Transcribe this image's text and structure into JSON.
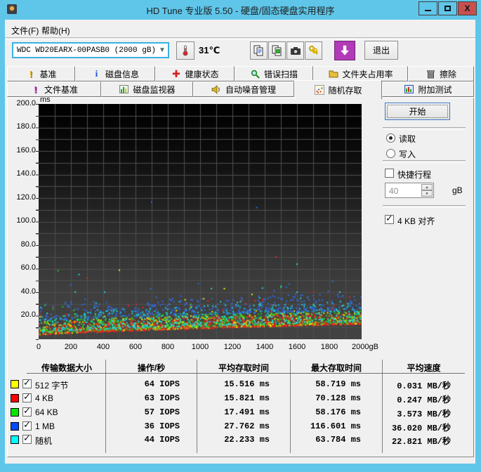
{
  "window": {
    "title": "HD Tune 专业版 5.50 - 硬盘/固态硬盘实用程序",
    "controls": {
      "close": "X"
    }
  },
  "menu": {
    "items": [
      {
        "label": "文件(F)"
      },
      {
        "label": "帮助(H)"
      }
    ]
  },
  "toolbar": {
    "drive_selected": "WDC WD20EARX-00PASB0  (2000 gB)",
    "temperature": "31℃",
    "exit_label": "退出"
  },
  "tabs": {
    "row1": [
      {
        "label": "基准"
      },
      {
        "label": "磁盘信息"
      },
      {
        "label": "健康状态"
      },
      {
        "label": "错误扫描"
      },
      {
        "label": "文件夹占用率"
      },
      {
        "label": "擦除"
      }
    ],
    "row2": [
      {
        "label": "文件基准"
      },
      {
        "label": "磁盘监视器"
      },
      {
        "label": "自动噪音管理"
      },
      {
        "label": "随机存取",
        "active": true
      },
      {
        "label": "附加测试"
      }
    ]
  },
  "panel": {
    "start_label": "开始",
    "read_label": "读取",
    "write_label": "写入",
    "read_selected": true,
    "write_selected": false,
    "shortstroke_label": "快捷行程",
    "shortstroke_checked": false,
    "shortstroke_value": "40",
    "shortstroke_unit": "gB",
    "align_label": "4 KB 对齐",
    "align_checked": true
  },
  "chart_data": {
    "type": "scatter",
    "y_unit": "ms",
    "x_unit": "gB",
    "xlim": [
      0,
      2000
    ],
    "ylim": [
      0,
      200
    ],
    "x_tick_labels": [
      "0",
      "200",
      "400",
      "600",
      "800",
      "1000",
      "1200",
      "1400",
      "1600",
      "1800",
      "2000gB"
    ],
    "y_tick_labels": [
      "200.0",
      "180.0",
      "160.0",
      "140.0",
      "120.0",
      "100.0",
      "80.0",
      "60.0",
      "40.0",
      "20.0"
    ],
    "grid": {
      "x_step": 100,
      "y_step": 10
    },
    "grid_color": "#4f4f4f",
    "bg_gradient": [
      "#000000",
      "#0c0c0c",
      "#1f1f1f",
      "#333333",
      "#3f3f3f",
      "#434343"
    ],
    "seed": 1337,
    "baseline": {
      "b0": 3.2,
      "rise": 9.5,
      "pow": 0.75
    },
    "draw_order": [
      0,
      2,
      1,
      4,
      3
    ],
    "series": [
      {
        "name": "512 字节",
        "dot_color": "#eded00",
        "count": 650,
        "offset": 0.4,
        "spread": 11,
        "tail": 18,
        "tail_p": 0.05,
        "outliers": [
          [
            500,
            58.7
          ],
          [
            1150,
            43
          ]
        ],
        "stats": {
          "iops": "64 IOPS",
          "avg_access": "15.516 ms",
          "max_access": "58.719 ms",
          "avg_speed": "0.031 MB/秒"
        }
      },
      {
        "name": "4 KB",
        "dot_color": "#ee2222",
        "count": 650,
        "offset": 0.0,
        "spread": 10,
        "tail": 22,
        "tail_p": 0.05,
        "outliers": [
          [
            1470,
            70.1
          ],
          [
            300,
            52
          ]
        ],
        "stats": {
          "iops": "63 IOPS",
          "avg_access": "15.821 ms",
          "max_access": "70.128 ms",
          "avg_speed": "0.247 MB/秒"
        }
      },
      {
        "name": "64 KB",
        "dot_color": "#22cc22",
        "count": 620,
        "offset": 1.2,
        "spread": 12,
        "tail": 16,
        "tail_p": 0.06,
        "outliers": [
          [
            120,
            58.2
          ],
          [
            1500,
            44
          ]
        ],
        "stats": {
          "iops": "57 IOPS",
          "avg_access": "17.491 ms",
          "max_access": "58.176 ms",
          "avg_speed": "3.573 MB/秒"
        }
      },
      {
        "name": "1 MB",
        "dot_color": "#2e6be8",
        "count": 430,
        "offset": 12,
        "spread": 15,
        "tail": 18,
        "tail_p": 0.05,
        "outliers": [
          [
            700,
            116.6
          ],
          [
            1350,
            112
          ]
        ],
        "stats": {
          "iops": "36 IOPS",
          "avg_access": "27.762 ms",
          "max_access": "116.601 ms",
          "avg_speed": "36.020 MB/秒"
        }
      },
      {
        "name": "随机",
        "dot_color": "#1fd8e0",
        "count": 520,
        "offset": 2.5,
        "spread": 17,
        "tail": 22,
        "tail_p": 0.08,
        "outliers": [
          [
            1600,
            63.8
          ],
          [
            250,
            55
          ]
        ],
        "stats": {
          "iops": "44 IOPS",
          "avg_access": "22.233 ms",
          "max_access": "63.784 ms",
          "avg_speed": "22.821 MB/秒"
        }
      }
    ]
  },
  "table": {
    "headers": [
      "传输数据大小",
      "操作/秒",
      "平均存取时间",
      "最大存取时间",
      "平均速度"
    ],
    "rows": [
      {
        "swatch": "#ffff00",
        "checked": true,
        "label": "512 字节",
        "iops": "64 IOPS",
        "avg": "15.516 ms",
        "max": "58.719 ms",
        "speed": "0.031 MB/秒"
      },
      {
        "swatch": "#ff0000",
        "checked": true,
        "label": "4 KB",
        "iops": "63 IOPS",
        "avg": "15.821 ms",
        "max": "70.128 ms",
        "speed": "0.247 MB/秒"
      },
      {
        "swatch": "#00e800",
        "checked": true,
        "label": "64 KB",
        "iops": "57 IOPS",
        "avg": "17.491 ms",
        "max": "58.176 ms",
        "speed": "3.573 MB/秒"
      },
      {
        "swatch": "#0048ff",
        "checked": true,
        "label": "1 MB",
        "iops": "36 IOPS",
        "avg": "27.762 ms",
        "max": "116.601 ms",
        "speed": "36.020 MB/秒"
      },
      {
        "swatch": "#00ffff",
        "checked": true,
        "label": "随机",
        "iops": "44 IOPS",
        "avg": "22.233 ms",
        "max": "63.784 ms",
        "speed": "22.821 MB/秒"
      }
    ]
  }
}
